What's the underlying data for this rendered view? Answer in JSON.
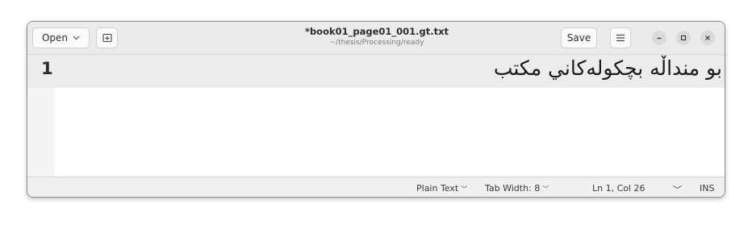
{
  "header": {
    "open_label": "Open",
    "save_label": "Save",
    "title": "*book01_page01_001.gt.txt",
    "subtitle": "~/thesis/Processing/ready"
  },
  "icons": {
    "open_dropdown": "chevron-down-icon",
    "new_tab": "new-tab-icon",
    "menu": "hamburger-menu-icon",
    "minimize": "minimize-icon",
    "maximize": "maximize-icon",
    "close": "close-icon"
  },
  "editor": {
    "lines": [
      {
        "number": "1",
        "text": "بو منداڵه بچكولەكاني مكتب"
      }
    ]
  },
  "statusbar": {
    "language": "Plain Text",
    "tab_width": "Tab Width: 8",
    "position": "Ln 1, Col 26",
    "mode": "INS"
  },
  "colors": {
    "header_bg": "#ebebeb",
    "current_line_bg": "#ececec",
    "statusbar_bg": "#f0f0f0"
  }
}
